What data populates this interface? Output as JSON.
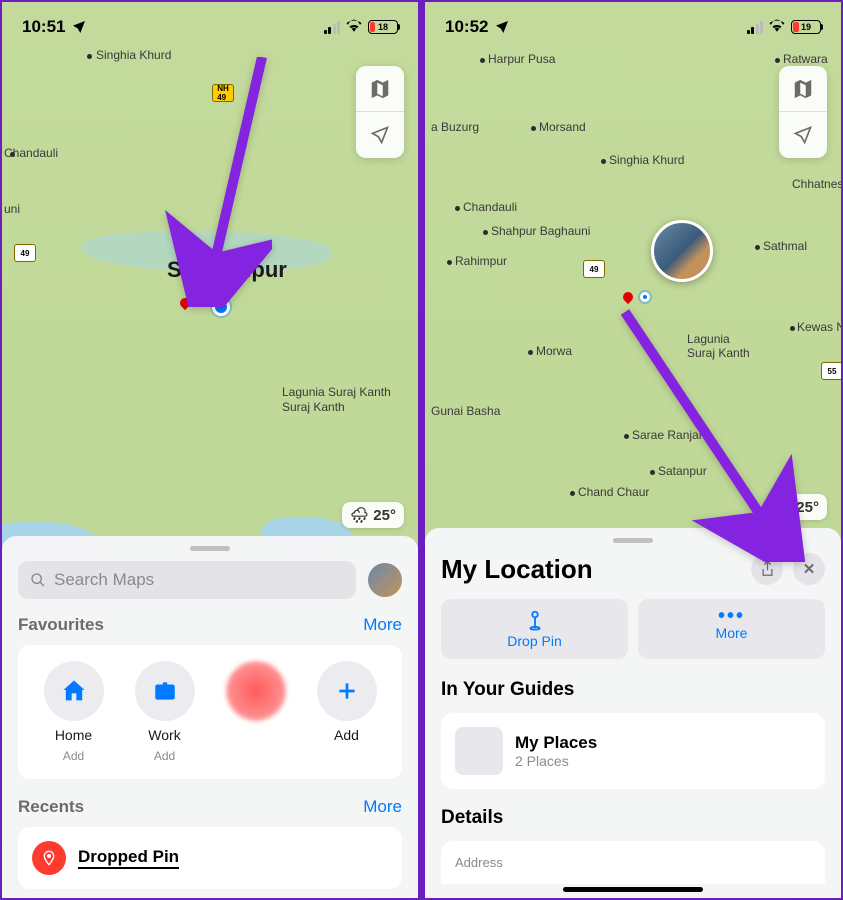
{
  "left": {
    "status": {
      "time": "10:51",
      "battery_pct": "18"
    },
    "city": "Samastipur",
    "towns": [
      "Singhia Khurd",
      "Chandauli",
      "Lagunia Suraj Kanth"
    ],
    "highway": "NH 49",
    "weather": "🌧 25°",
    "search_placeholder": "Search Maps",
    "favourites_label": "Favourites",
    "more_label": "More",
    "fav_items": [
      {
        "name": "Home",
        "sub": "Add"
      },
      {
        "name": "Work",
        "sub": "Add"
      },
      {
        "name": "",
        "sub": ""
      },
      {
        "name": "Add",
        "sub": ""
      }
    ],
    "recents_label": "Recents",
    "recent_title": "Dropped Pin"
  },
  "right": {
    "status": {
      "time": "10:52",
      "battery_pct": "19"
    },
    "towns": [
      "Harpur Pusa",
      "Ratwara",
      "a Buzurg",
      "Morsand",
      "Singhia Khurd",
      "Chhatnesh",
      "Chandauli",
      "Shahpur Baghauni",
      "Rahimpur",
      "Sathmal",
      "Morwa",
      "Lagunia Suraj Kanth",
      "Kewas Niz",
      "Gunai Basha",
      "Sarae Ranjan",
      "Satanpur",
      "Chand Chaur"
    ],
    "highway1": "49",
    "highway2": "55",
    "weather": "🌧 25°",
    "sheet_title": "My Location",
    "drop_pin_label": "Drop Pin",
    "more_btn_label": "More",
    "guides_title": "In Your Guides",
    "guide_name": "My Places",
    "guide_sub": "2 Places",
    "details_title": "Details",
    "address_label": "Address"
  }
}
